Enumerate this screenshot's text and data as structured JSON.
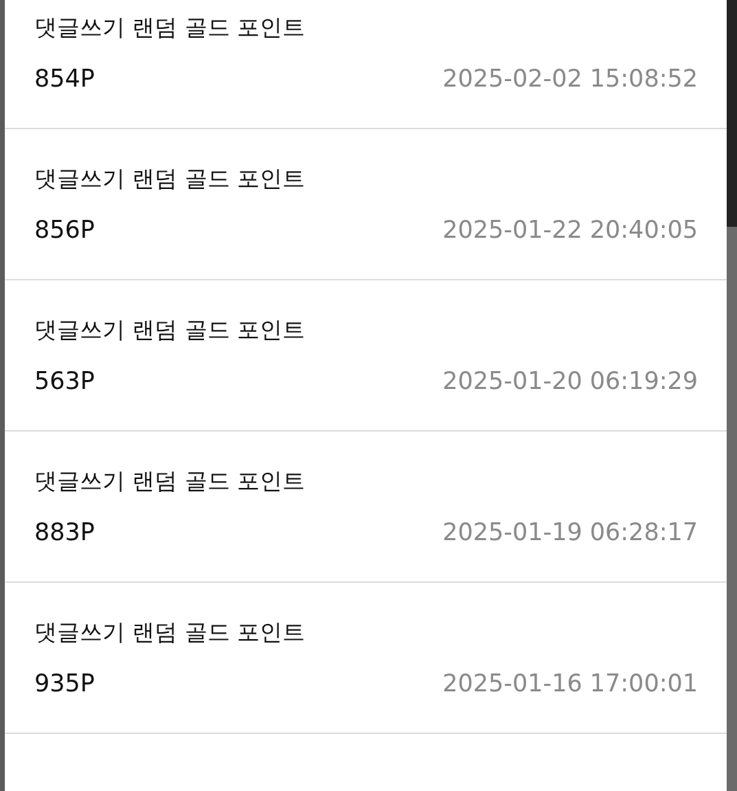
{
  "points_history": [
    {
      "title": "댓글쓰기 랜덤 골드 포인트",
      "amount": "854P",
      "date": "2025-02-02 15:08:52"
    },
    {
      "title": "댓글쓰기 랜덤 골드 포인트",
      "amount": "856P",
      "date": "2025-01-22 20:40:05"
    },
    {
      "title": "댓글쓰기 랜덤 골드 포인트",
      "amount": "563P",
      "date": "2025-01-20 06:19:29"
    },
    {
      "title": "댓글쓰기 랜덤 골드 포인트",
      "amount": "883P",
      "date": "2025-01-19 06:28:17"
    },
    {
      "title": "댓글쓰기 랜덤 골드 포인트",
      "amount": "935P",
      "date": "2025-01-16 17:00:01"
    }
  ]
}
